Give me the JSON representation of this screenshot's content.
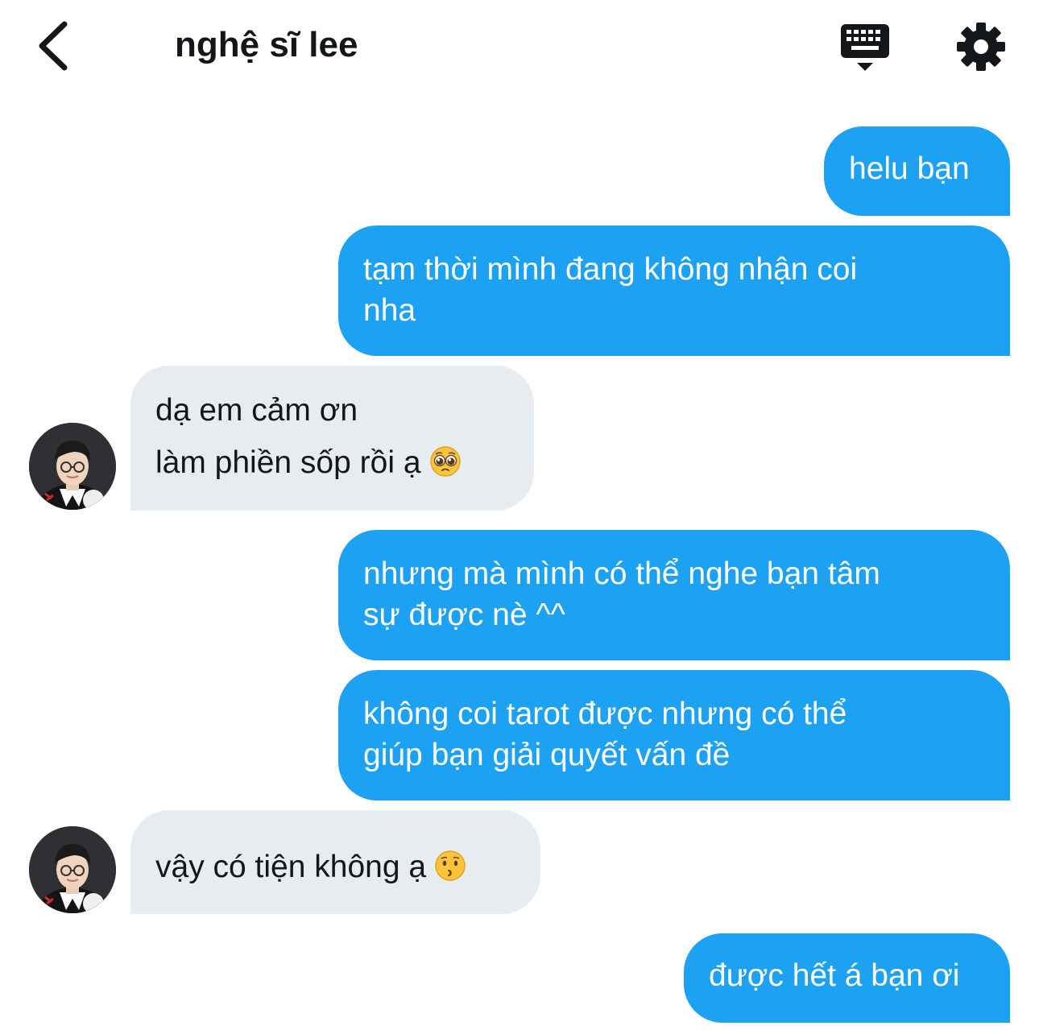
{
  "header": {
    "title": "nghệ sĩ lee"
  },
  "messages": [
    {
      "from": "me",
      "lines": [
        "helu bạn"
      ]
    },
    {
      "from": "me",
      "lines": [
        "tạm thời mình đang không nhận coi",
        "nha"
      ]
    },
    {
      "from": "them",
      "lines": [
        "dạ em cảm ơn",
        "làm phiền sốp rồi ạ"
      ],
      "emoji": "pleading-face-icon"
    },
    {
      "from": "me",
      "lines": [
        "nhưng mà mình có thể nghe bạn tâm",
        "sự được nè ^^"
      ]
    },
    {
      "from": "me",
      "lines": [
        "không coi tarot được nhưng có thể",
        "giúp bạn giải quyết vấn đề"
      ]
    },
    {
      "from": "them",
      "lines": [
        "vậy có tiện không ạ"
      ],
      "emoji": "kissing-face-icon"
    },
    {
      "from": "me",
      "lines": [
        "được hết á bạn ơi"
      ]
    }
  ],
  "colors": {
    "sent_bubble": "#1da1f2",
    "received_bubble": "#e6ecf0",
    "text_dark": "#14171a"
  }
}
